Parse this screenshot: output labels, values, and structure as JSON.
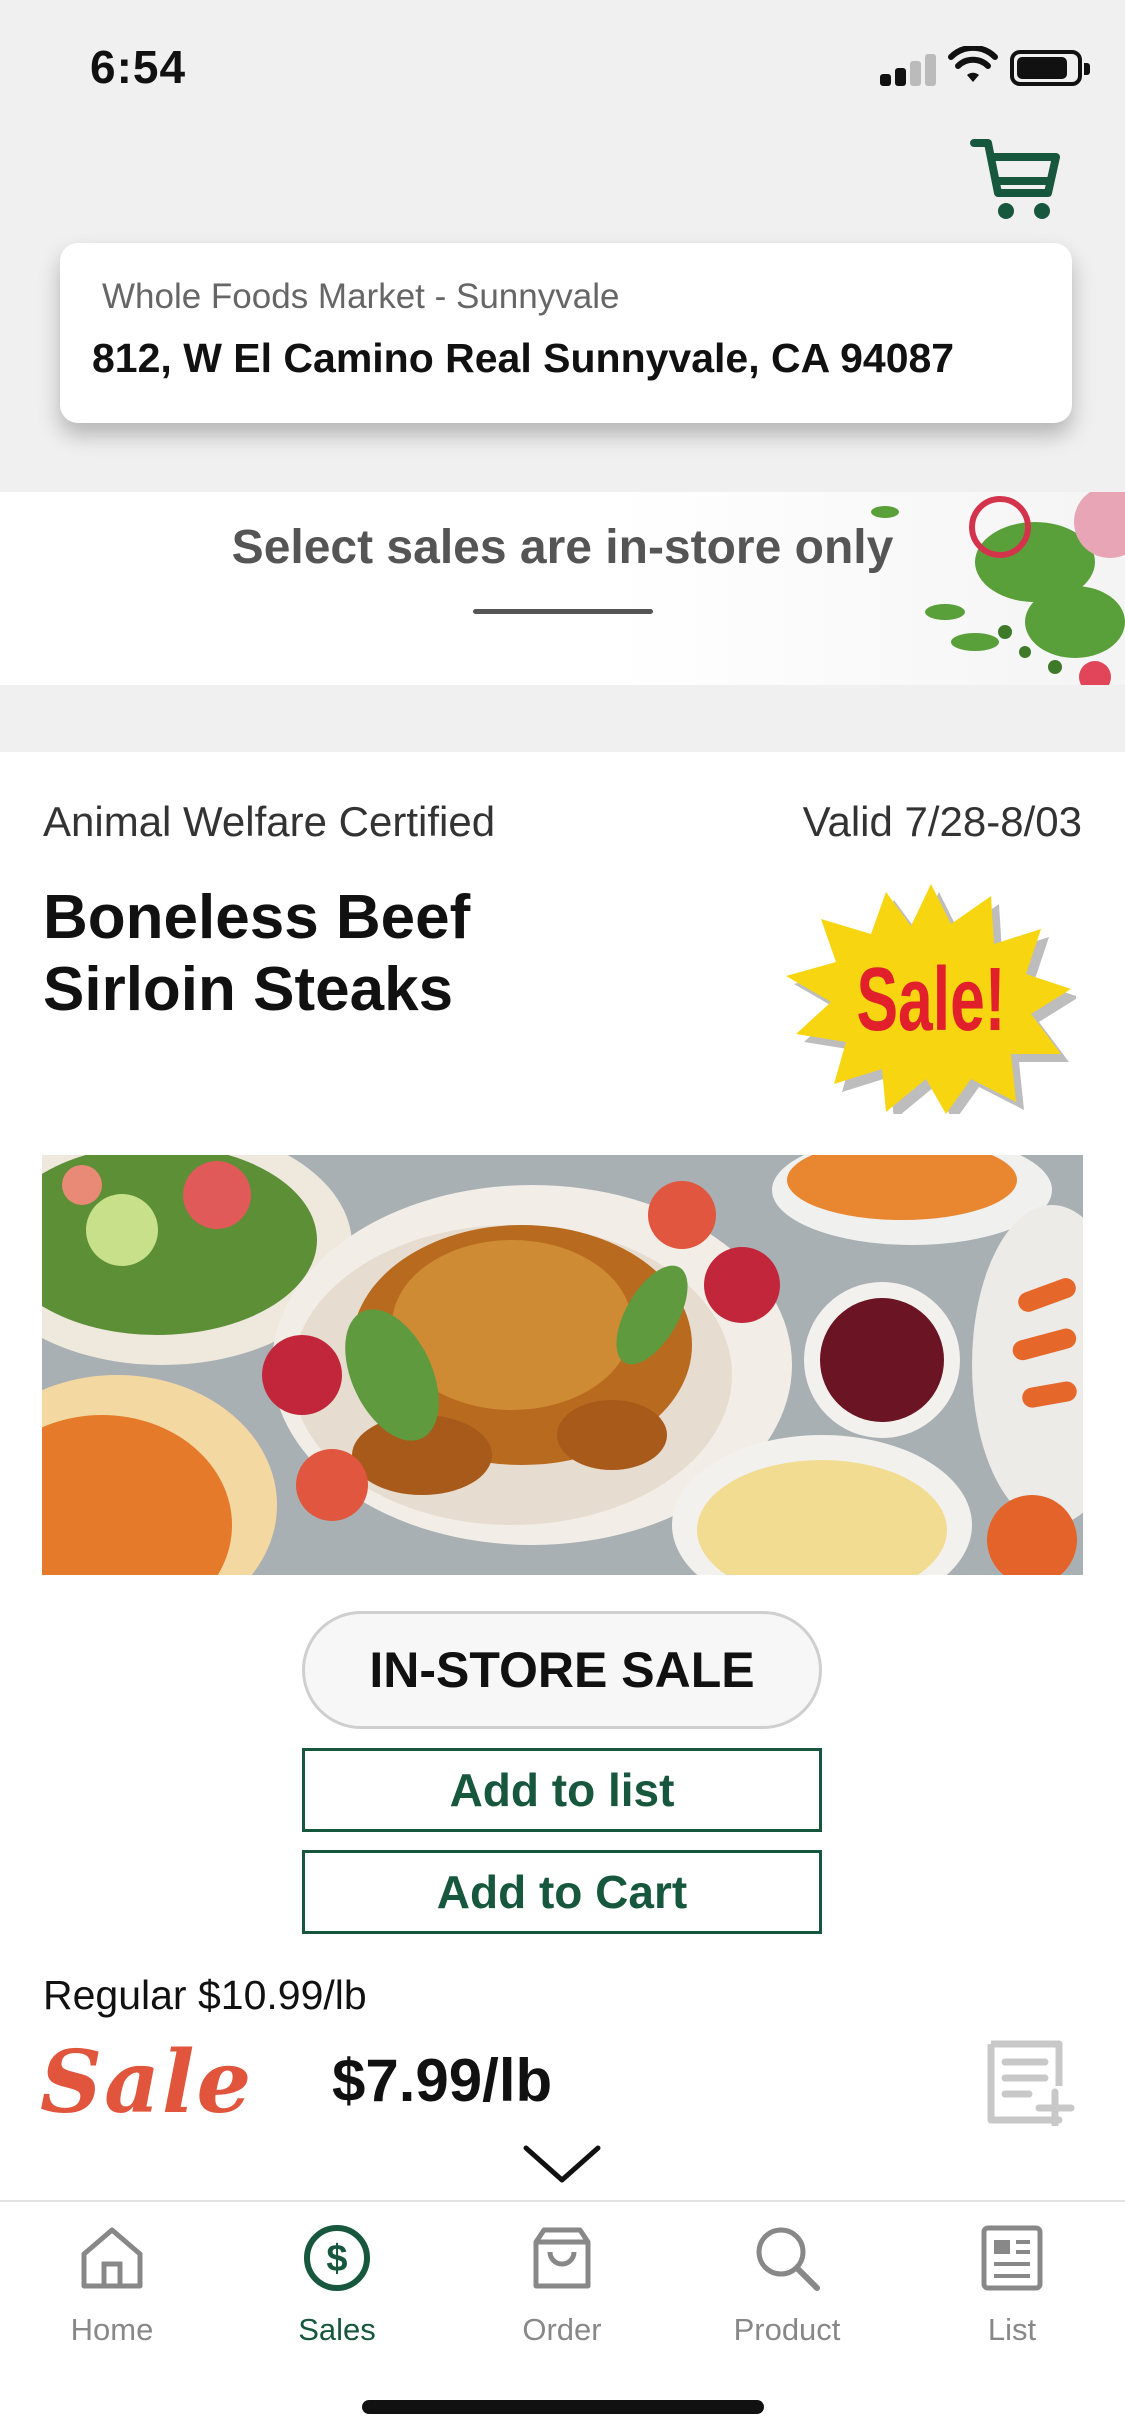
{
  "status_bar": {
    "time": "6:54"
  },
  "store": {
    "name": "Whole Foods Market - Sunnyvale",
    "address": "812, W El Camino Real Sunnyvale, CA 94087"
  },
  "banner": {
    "text": "Select sales are in-store only"
  },
  "product": {
    "certification": "Animal Welfare Certified",
    "valid": "Valid 7/28-8/03",
    "title": "Boneless Beef Sirloin Steaks",
    "badge_text": "Sale!",
    "instore_label": "IN-STORE SALE",
    "add_to_list_label": "Add to list",
    "add_to_cart_label": "Add to Cart",
    "regular_price": "Regular $10.99/lb",
    "sale_word": "Sale",
    "sale_price": "$7.99/lb"
  },
  "tabs": [
    {
      "label": "Home",
      "icon": "home-icon",
      "active": false
    },
    {
      "label": "Sales",
      "icon": "sales-dollar-icon",
      "active": true
    },
    {
      "label": "Order",
      "icon": "shopping-bag-icon",
      "active": false
    },
    {
      "label": "Product",
      "icon": "search-icon",
      "active": false
    },
    {
      "label": "List",
      "icon": "list-document-icon",
      "active": false
    }
  ],
  "colors": {
    "brand_green": "#17573d",
    "sale_red": "#e0553c",
    "badge_yellow": "#f7d511",
    "badge_text_red": "#e2202c"
  }
}
